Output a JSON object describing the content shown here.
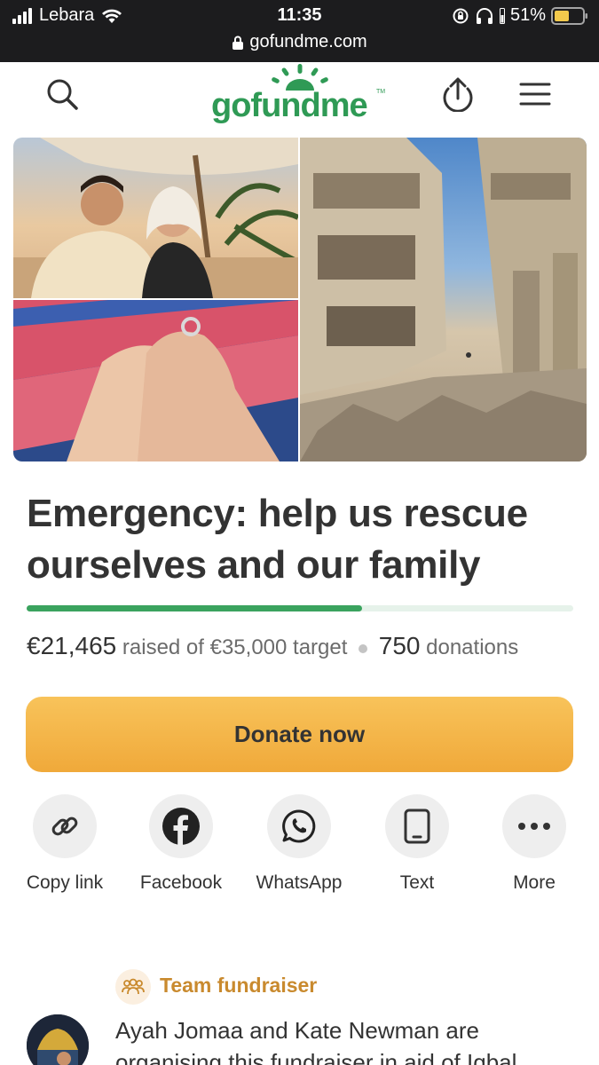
{
  "status_bar": {
    "carrier": "Lebara",
    "time": "11:35",
    "url": "gofundme.com",
    "battery": "51%"
  },
  "header": {
    "logo_text": "gofundme",
    "logo_tm": "TM",
    "icons": [
      "search-icon",
      "share-upload-icon",
      "menu-icon"
    ]
  },
  "campaign": {
    "title": "Emergency: help us rescue ourselves and our family",
    "raised": "€21,465",
    "raised_suffix": "raised of €35,000 target",
    "donations_count": "750",
    "donations_label": "donations",
    "progress_fraction": 0.613,
    "progress_color": "#3aa35e"
  },
  "donate": {
    "label": "Donate now",
    "color": "#f0a93a"
  },
  "share": [
    {
      "label": "Copy link",
      "icon": "link-icon"
    },
    {
      "label": "Facebook",
      "icon": "facebook-icon"
    },
    {
      "label": "WhatsApp",
      "icon": "whatsapp-icon"
    },
    {
      "label": "Text",
      "icon": "phone-icon"
    },
    {
      "label": "More",
      "icon": "more-icon"
    }
  ],
  "team": {
    "label": "Team fundraiser",
    "organiser_text": "Ayah Jomaa and Kate Newman are organising this fundraiser in aid of Iqbal"
  }
}
